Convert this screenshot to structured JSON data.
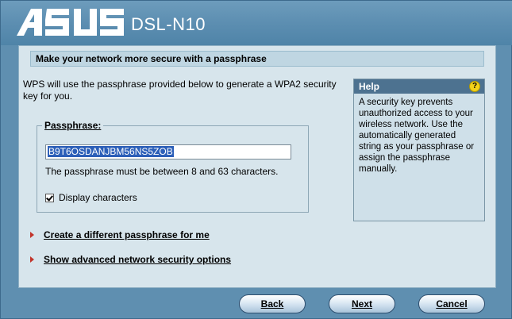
{
  "header": {
    "brand": "ASUS",
    "model": "DSL-N10"
  },
  "main": {
    "title": "Make your network more secure with a passphrase",
    "intro": "WPS will use the passphrase provided below to generate a WPA2 security key for you.",
    "passphrase_group_label": "Passphrase:",
    "passphrase_value": "B9T6OSDANJBM56NS5ZOB",
    "passphrase_note": "The passphrase must be between 8 and 63 characters.",
    "display_characters_label": "Display characters",
    "display_characters_checked": true
  },
  "help": {
    "title": "Help",
    "body": "A security key prevents unauthorized access to your wireless network. Use the automatically generated string as your passphrase or assign the passphrase manually."
  },
  "links": {
    "different_passphrase": "Create a different passphrase for me",
    "advanced_options": "Show advanced network security options"
  },
  "buttons": {
    "back": "Back",
    "next": "Next",
    "cancel": "Cancel"
  },
  "colors": {
    "frame": "#5f8fb0",
    "panel": "#d7e5ec",
    "help_header": "#4d7290",
    "link_arrow": "#c2352b",
    "selection": "#2c5fb8"
  }
}
